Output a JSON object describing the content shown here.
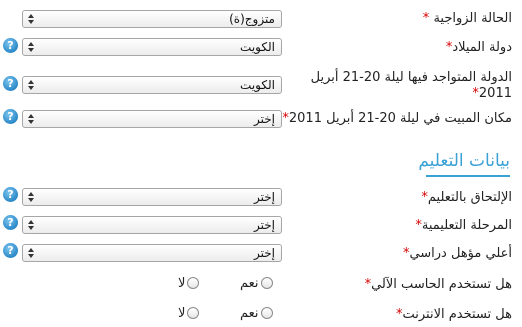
{
  "fields": [
    {
      "label": "الحالة الزواجية",
      "value": "متزوج(ة)",
      "has_help": false
    },
    {
      "label": "دولة الميلاد",
      "value": "الكويت",
      "has_help": true
    },
    {
      "label": "الدولة المتواجد فيها ليلة 20-21 أبريل 2011",
      "value": "الكويت",
      "has_help": true
    },
    {
      "label": "مكان المبيت في ليلة 20-21 أبريل 2011",
      "value": "إختر",
      "has_help": true
    }
  ],
  "education_section": {
    "title": "بيانات التعليم",
    "fields": [
      {
        "label": "الإلتحاق بالتعليم",
        "value": "إختر",
        "has_help": true
      },
      {
        "label": "المرحلة التعليمية",
        "value": "إختر",
        "has_help": true
      },
      {
        "label": "أعلي مؤهل دراسي",
        "value": "إختر",
        "has_help": true
      }
    ],
    "radios": [
      {
        "label": "هل تستخدم الحاسب الآلي",
        "yes": "نعم",
        "no": "لا"
      },
      {
        "label": "هل تستخدم الانترنت",
        "yes": "نعم",
        "no": "لا"
      }
    ]
  },
  "required_mark": "*",
  "help_glyph": "?",
  "colors": {
    "accent": "#3aa1d5",
    "required": "#d40000",
    "help_icon": "#2a88c8"
  }
}
